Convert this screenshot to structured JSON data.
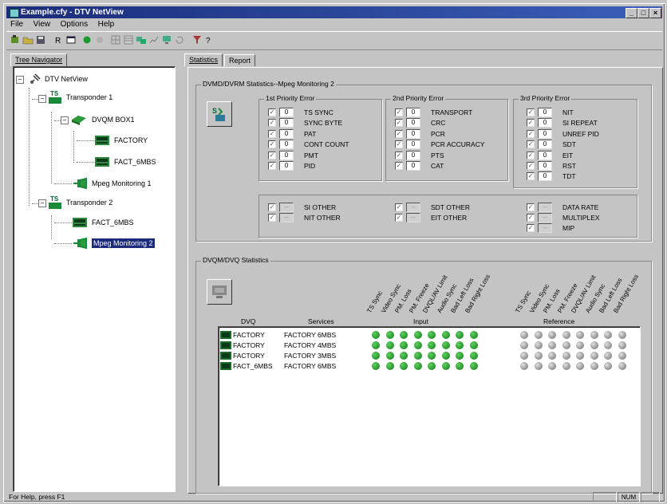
{
  "window": {
    "title": "Example.cfy - DTV NetView"
  },
  "menu": [
    "File",
    "View",
    "Options",
    "Help"
  ],
  "toolbar_icons": [
    "new-icon",
    "open-icon",
    "save-icon",
    "select-icon",
    "window-icon",
    "record-icon",
    "stop-icon",
    "grid-icon",
    "table-icon",
    "network-icon",
    "chart-icon",
    "monitor-icon",
    "refresh-icon",
    "filter-icon",
    "help-icon"
  ],
  "tree_tab": "Tree Navigator",
  "tree": {
    "root": "DTV NetView",
    "transponder1": "Transponder 1",
    "dvqm": "DVQM BOX1",
    "factory": "FACTORY",
    "fact6a": "FACT_6MBS",
    "mpeg1": "Mpeg Monitoring 1",
    "transponder2": "Transponder 2",
    "fact6b": "FACT_6MBS",
    "mpeg2": "Mpeg Monitoring 2"
  },
  "tabs": {
    "statistics": "Statistics",
    "report": "Report"
  },
  "dvmd": {
    "title": "DVMD/DVRM Statistics--Mpeg Monitoring 2",
    "p1_title": "1st Priority Error",
    "p2_title": "2nd Priority Error",
    "p3_title": "3rd Priority Error",
    "p1": [
      {
        "label": "TS SYNC",
        "count": "0"
      },
      {
        "label": "SYNC BYTE",
        "count": "0"
      },
      {
        "label": "PAT",
        "count": "0"
      },
      {
        "label": "CONT COUNT",
        "count": "0"
      },
      {
        "label": "PMT",
        "count": "0"
      },
      {
        "label": "PID",
        "count": "0"
      }
    ],
    "p2": [
      {
        "label": "TRANSPORT",
        "count": "0"
      },
      {
        "label": "CRC",
        "count": "0"
      },
      {
        "label": "PCR",
        "count": "0"
      },
      {
        "label": "PCR ACCURACY",
        "count": "0"
      },
      {
        "label": "PTS",
        "count": "0"
      },
      {
        "label": "CAT",
        "count": "0"
      }
    ],
    "p3": [
      {
        "label": "NIT",
        "count": "0"
      },
      {
        "label": "SI REPEAT",
        "count": "0"
      },
      {
        "label": "UNREF PID",
        "count": "0"
      },
      {
        "label": "SDT",
        "count": "0"
      },
      {
        "label": "EIT",
        "count": "0"
      },
      {
        "label": "RST",
        "count": "0"
      },
      {
        "label": "TDT",
        "count": "0"
      }
    ],
    "other1": [
      {
        "label": "SI OTHER",
        "count": "--"
      },
      {
        "label": "NIT OTHER",
        "count": "--"
      }
    ],
    "other2": [
      {
        "label": "SDT OTHER",
        "count": "--"
      },
      {
        "label": "EIT OTHER",
        "count": "--"
      }
    ],
    "other3": [
      {
        "label": "DATA RATE",
        "count": "--"
      },
      {
        "label": "MULTIPLEX",
        "count": "--"
      },
      {
        "label": "MIP",
        "count": "--"
      }
    ]
  },
  "dvqm": {
    "title": "DVQM/DVQ Statistics",
    "col_dvq": "DVQ",
    "col_services": "Services",
    "col_input": "Input",
    "col_reference": "Reference",
    "input_headers": [
      "TS Sync",
      "Video Sync",
      "PM. Loss",
      "PM. Freeze",
      "DVQL/AV Limit",
      "Audio Sync",
      "Bad Left Loss",
      "Bad Right Loss"
    ],
    "reference_headers": [
      "TS Sync",
      "Video Sync",
      "PM. Loss",
      "PM. Freeze",
      "DVQL/AV Limit",
      "Audio Sync",
      "Bad Left Loss",
      "Bad Right Loss"
    ],
    "rows": [
      {
        "dvq": "FACTORY",
        "service": "FACTORY 6MBS"
      },
      {
        "dvq": "FACTORY",
        "service": "FACTORY 4MBS"
      },
      {
        "dvq": "FACTORY",
        "service": "FACTORY 3MBS"
      },
      {
        "dvq": "FACT_6MBS",
        "service": "FACTORY 6MBS"
      }
    ],
    "input_color": "#1a8a2a",
    "reference_color": "#8a8a8a"
  },
  "status": {
    "help": "For Help, press F1",
    "num": "NUM"
  }
}
